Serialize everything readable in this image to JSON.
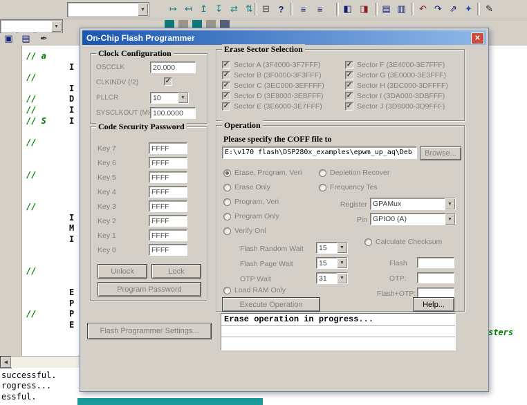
{
  "window": {
    "title": "On-Chip Flash Programmer",
    "close_glyph": "✕"
  },
  "ui": {
    "check_glyph": "✓",
    "dropdown_glyph": "▼",
    "scroll_left_glyph": "◀"
  },
  "toolbar": {
    "main_icons": [
      "↦",
      "↤",
      "↥",
      "↧",
      "⇄",
      "⇅",
      "⊟",
      "?",
      "≡",
      "≡",
      "◧",
      "◨",
      "▤",
      "▥",
      "↶",
      "↷",
      "⇗",
      "✦",
      "✎"
    ],
    "side_icons": [
      "▣",
      "▤",
      "✒"
    ]
  },
  "editor": {
    "green_fragments": [
      "// a",
      "//",
      "//",
      "//",
      "// S",
      "//",
      "//",
      "//",
      "//",
      "//"
    ],
    "black_fragments": [
      "I",
      "I",
      "D",
      "I",
      "I",
      "I",
      "M",
      "I",
      "E",
      "P",
      "P",
      "E"
    ],
    "right_fragment": "sters",
    "output_lines": [
      "successful.",
      "rogress...",
      "essful."
    ]
  },
  "dialog": {
    "clock": {
      "title": "Clock Configuration",
      "oscclk_label": "OSCCLK",
      "oscclk_value": "20.000",
      "clkindv_label": "CLKINDV (/2)",
      "clkindv_checked": true,
      "pllcr_label": "PLLCR",
      "pllcr_value": "10",
      "sysclkout_label": "SYSCLKOUT (MHz):",
      "sysclkout_value": "100.0000"
    },
    "erase": {
      "title": "Erase Sector Selection",
      "left": [
        {
          "label": "Sector A (3F4000-3F7FFF)",
          "checked": true
        },
        {
          "label": "Sector B (3F0000-3F3FFF)",
          "checked": true
        },
        {
          "label": "Sector C (3EC000-3EFFFF)",
          "checked": true
        },
        {
          "label": "Sector D (3E8000-3EBFFF)",
          "checked": true
        },
        {
          "label": "Sector E (3E6000-3E7FFF)",
          "checked": true
        }
      ],
      "right": [
        {
          "label": "Sector F (3E4000-3E7FFF)",
          "checked": true
        },
        {
          "label": "Sector G (3E0000-3E3FFF)",
          "checked": true
        },
        {
          "label": "Sector H (3DC000-3DFFFF)",
          "checked": true
        },
        {
          "label": "Sector I (3DA000-3DBFFF)",
          "checked": true
        },
        {
          "label": "Sector J (3D8000-3D9FFF)",
          "checked": true
        }
      ]
    },
    "password": {
      "title": "Code Security Password",
      "keys": [
        {
          "label": "Key 7",
          "value": "FFFF"
        },
        {
          "label": "Key 6",
          "value": "FFFF"
        },
        {
          "label": "Key 5",
          "value": "FFFF"
        },
        {
          "label": "Key 4",
          "value": "FFFF"
        },
        {
          "label": "Key 3",
          "value": "FFFF"
        },
        {
          "label": "Key 2",
          "value": "FFFF"
        },
        {
          "label": "Key 1",
          "value": "FFFF"
        },
        {
          "label": "Key 0",
          "value": "FFFF"
        }
      ],
      "unlock_label": "Unlock",
      "lock_label": "Lock",
      "program_label": "Program Password"
    },
    "settings_label": "Flash Programmer Settings...",
    "operation": {
      "title": "Operation",
      "prompt": "Please specify the COFF file to",
      "coff_path": "E:\\v170 flash\\DSP280x_examples\\epwm_up_aq\\Deb",
      "browse_label": "Browse...",
      "mode_options": [
        "Erase, Program, Veri",
        "Erase Only",
        "Program, Veri",
        "Program Only",
        "Verify Onl"
      ],
      "selected_mode": "Erase, Program, Veri",
      "aux_options": [
        "Depletion Recover",
        "Frequency Tes"
      ],
      "register_label": "Register",
      "register_value": "GPAMux",
      "pin_label": "Pin",
      "pin_value": "GPIO0 (A)",
      "flash_random_wait_label": "Flash Random Wait",
      "flash_random_wait_value": "15",
      "flash_page_wait_label": "Flash Page Wait",
      "flash_page_wait_value": "15",
      "otp_wait_label": "OTP Wait",
      "otp_wait_value": "31",
      "load_ram_label": "Load RAM Only",
      "checksum_label": "Calculate Checksum",
      "flash_label": "Flash",
      "otp_label": "OTP:",
      "flash_otp_label": "Flash+OTP:",
      "flash_value": "",
      "otp_value": "",
      "flash_otp_value": "",
      "execute_label": "Execute Operation",
      "help_label": "Help...",
      "status_text": "Erase operation in progress..."
    }
  },
  "colors": {
    "titlebar_gradient_start": "#1b56b0",
    "titlebar_gradient_end": "#8fb9e8",
    "close_button_red": "#cf4a3e",
    "dialog_bg": "#d4d0c8",
    "disabled_text": "#808080",
    "comment_green": "#007d00",
    "teal_bar": "#1b9a9a"
  }
}
